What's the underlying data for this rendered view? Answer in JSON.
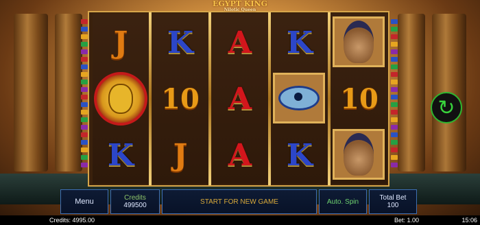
{
  "game": {
    "logo_title": "EGYPT KING",
    "logo_subtitle": "Nilotic Queen"
  },
  "reels": [
    [
      "J",
      "scarab",
      "K"
    ],
    [
      "K",
      "10",
      "J"
    ],
    [
      "A",
      "A",
      "A"
    ],
    [
      "K",
      "eye",
      "K"
    ],
    [
      "queen",
      "10",
      "queen"
    ]
  ],
  "symbols_text": {
    "r0c0": "J",
    "r2c0": "K",
    "r0c1": "K",
    "r1c1": "10",
    "r2c1": "J",
    "r0c2": "A",
    "r1c2": "A",
    "r2c2": "A",
    "r0c3": "K",
    "r2c3": "K",
    "r1c4": "10"
  },
  "paylines": {
    "left_colors": [
      "#c4262a",
      "#2a52c4",
      "#e6a520",
      "#26a043",
      "#8a2aa8",
      "#c4262a",
      "#2a52c4",
      "#e6a520",
      "#26a043",
      "#8a2aa8",
      "#c4262a",
      "#2a52c4",
      "#e6a520",
      "#26a043",
      "#8a2aa8",
      "#c4262a",
      "#2a52c4",
      "#e6a520",
      "#26a043",
      "#8a2aa8"
    ],
    "right_colors": [
      "#2a52c4",
      "#26a043",
      "#c4262a",
      "#e6a520",
      "#8a2aa8",
      "#2a52c4",
      "#26a043",
      "#c4262a",
      "#e6a520",
      "#8a2aa8",
      "#2a52c4",
      "#26a043",
      "#c4262a",
      "#e6a520",
      "#8a2aa8",
      "#2a52c4",
      "#26a043",
      "#c4262a",
      "#e6a520",
      "#8a2aa8"
    ]
  },
  "controls": {
    "spin_icon": "refresh-arrows-icon",
    "menu_label": "Menu",
    "credits_label": "Credits",
    "credits_value": "499500",
    "center_message": "START FOR NEW GAME",
    "auto_spin_label": "Auto. Spin",
    "total_bet_label": "Total Bet",
    "total_bet_value": "100"
  },
  "status_bar": {
    "credits": "Credits: 4995.00",
    "bet": "Bet: 1.00",
    "time": "15:06"
  }
}
